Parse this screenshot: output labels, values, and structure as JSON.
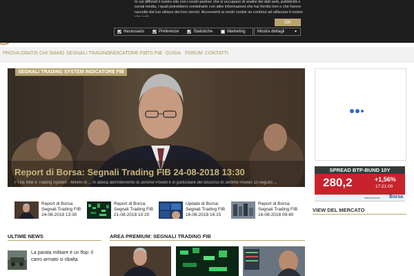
{
  "cookie": {
    "text": "In cui diffondi il nostro sito con i nostri partner che si occupano di analisi dei dati web, pubblicità e social media, i quali potrebbero combinarle con altre informazioni che hai fornito loro o che hanno raccolto dal tuo utilizzo dei loro servizi. Acconsenti ai nostri cookie se continui ad utilizzare il nostro sito web.",
    "ok_label": "OK",
    "options": [
      {
        "label": "Necessario",
        "checked": true
      },
      {
        "label": "Preferenze",
        "checked": true
      },
      {
        "label": "Statistiche",
        "checked": true
      },
      {
        "label": "Marketing",
        "checked": false
      }
    ],
    "details_label": "Mostra dettagli"
  },
  "nav": {
    "items": [
      "PROVA GRATIS",
      "CHI SIAMO",
      "SEGNALI TRADING",
      "INDICATORE FIB",
      "TS FIB",
      "GUIDA",
      "FORUM",
      "CONTATTI"
    ]
  },
  "hero": {
    "tag": "SEGNALI TRADING SYSTEM INDICATORE FIB",
    "title": "Report di Borsa: Segnali Trading FIB 24-08-2018 13:30",
    "caption": "FTSE MIB e Trading System - Minimi di ... in attesa dell'intervento di Jerome Powell e in particolare del discorso di Jerome Powell. Di seguito ..."
  },
  "thumbs": [
    {
      "line1": "Report di Borsa:",
      "line2": "Segnali Trading FIB",
      "line3": "24-08-2018 13:30"
    },
    {
      "line1": "Report di Borsa:",
      "line2": "Segnali Trading FIB",
      "line3": "21-08-2018 10:20"
    },
    {
      "line1": "Update di Borsa:",
      "line2": "Segnali Trading FIB",
      "line3": "16-08-2018 16:15"
    },
    {
      "line1": "Report di Borsa:",
      "line2": "Segnali Trading FIB",
      "line3": "16-08-2018 09:40"
    }
  ],
  "spread": {
    "title": "SPREAD BTP-BUND 10Y",
    "value": "280,2",
    "change": "+1,56%",
    "time": "17:21:00",
    "foot_label": "elaborazione",
    "brand": "Borsa"
  },
  "market": {
    "title": "VIEW DEL MERCATO"
  },
  "ultime": {
    "title": "ULTIME NEWS",
    "item_line1": "La parata militare è un flop: il",
    "item_line2": "carro armato si ribalta"
  },
  "premium": {
    "title": "AREA PREMIUM: SEGNALI TRADING FIB"
  },
  "colors": {
    "accent": "#b7a570",
    "spread_red": "#c8232c",
    "nav_text": "#a89556"
  }
}
